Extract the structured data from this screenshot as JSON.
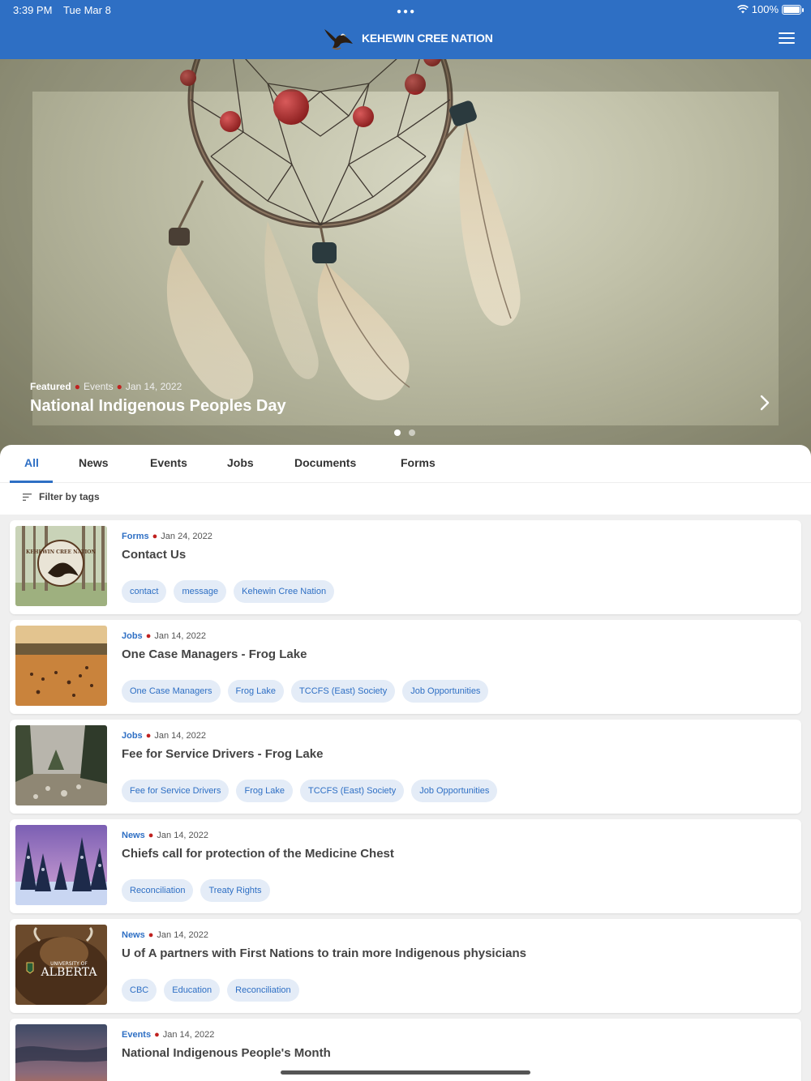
{
  "status": {
    "time": "3:39 PM",
    "date": "Tue Mar 8",
    "battery": "100%"
  },
  "app": {
    "title": "KEHEWIN CREE NATION"
  },
  "hero": {
    "featured_label": "Featured",
    "category": "Events",
    "date": "Jan 14, 2022",
    "title": "National Indigenous Peoples Day",
    "pages": 2,
    "current_page": 1
  },
  "tabs": [
    {
      "label": "All",
      "active": true
    },
    {
      "label": "News"
    },
    {
      "label": "Events"
    },
    {
      "label": "Jobs"
    },
    {
      "label": "Documents"
    },
    {
      "label": "Forms"
    }
  ],
  "filter": {
    "label": "Filter by tags"
  },
  "items": [
    {
      "category": "Forms",
      "date": "Jan 24, 2022",
      "title": "Contact Us",
      "tags": [
        "contact",
        "message",
        "Kehewin Cree Nation"
      ]
    },
    {
      "category": "Jobs",
      "date": "Jan 14, 2022",
      "title": "One Case Managers - Frog Lake",
      "tags": [
        "One Case Managers",
        "Frog Lake",
        "TCCFS (East) Society",
        "Job Opportunities"
      ]
    },
    {
      "category": "Jobs",
      "date": "Jan 14, 2022",
      "title": "Fee for Service Drivers - Frog Lake",
      "tags": [
        "Fee for Service Drivers",
        "Frog Lake",
        "TCCFS (East) Society",
        "Job Opportunities"
      ]
    },
    {
      "category": "News",
      "date": "Jan 14, 2022",
      "title": "Chiefs call for protection of the Medicine Chest",
      "tags": [
        "Reconciliation",
        "Treaty Rights"
      ]
    },
    {
      "category": "News",
      "date": "Jan 14, 2022",
      "title": "U of A partners with First Nations to train more Indigenous physicians",
      "tags": [
        "CBC",
        "Education",
        "Reconciliation"
      ]
    },
    {
      "category": "Events",
      "date": "Jan 14, 2022",
      "title": "National Indigenous People's Month",
      "tags": []
    }
  ],
  "thumb_logo_text": {
    "seal": "KEHEWIN CREE NATION",
    "univ_small": "UNIVERSITY OF",
    "univ_big": "ALBERTA"
  },
  "colors": {
    "primary": "#2e6fc4",
    "accent_dot": "#c0211f",
    "tag_bg": "#e4ecf7"
  }
}
